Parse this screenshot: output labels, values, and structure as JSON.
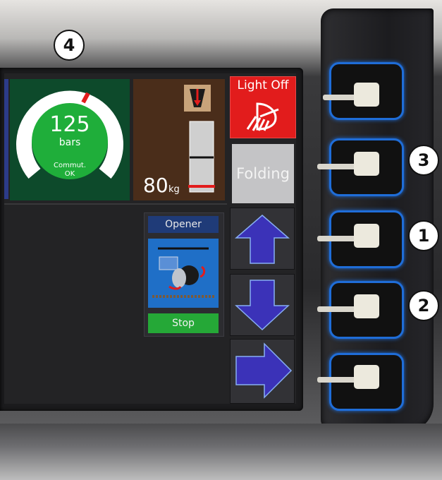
{
  "gauge": {
    "value": "125",
    "unit": "bars",
    "status_line1": "Commut.",
    "status_line2": "OK"
  },
  "weight": {
    "value": "80",
    "unit": "kg"
  },
  "buttons": {
    "light_off": "Light Off",
    "folding": "Folding"
  },
  "opener": {
    "label": "Opener",
    "stop": "Stop"
  },
  "callouts": {
    "c1": "1",
    "c2": "2",
    "c3": "3",
    "c4": "4"
  },
  "icons": [
    "headlight-icon",
    "hitch-lift-icon",
    "arrow-up-icon",
    "arrow-down-icon",
    "arrow-right-icon",
    "opener-disc-icon"
  ],
  "colors": {
    "light_off_bg": "#e21c1c",
    "gauge_green": "#1fae3a",
    "arrow_blue": "#3b32b8",
    "stop_green": "#25a837",
    "button_glow": "#1f6dd8"
  }
}
